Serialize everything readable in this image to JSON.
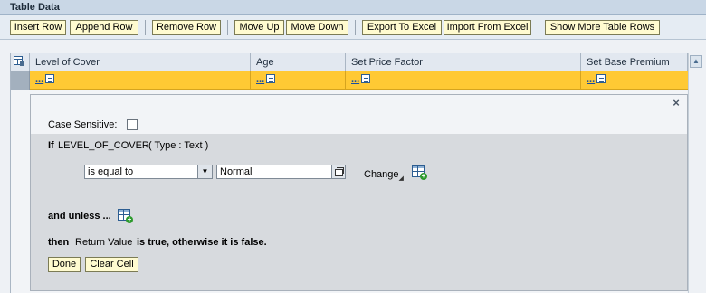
{
  "panel": {
    "title": "Table Data"
  },
  "toolbar": {
    "insert_row": "Insert Row",
    "append_row": "Append Row",
    "remove_row": "Remove Row",
    "move_up": "Move Up",
    "move_down": "Move Down",
    "export_excel": "Export To Excel",
    "import_excel": "Import From Excel",
    "show_more_rows": "Show More Table Rows"
  },
  "table": {
    "columns": [
      "Level of Cover",
      "Age",
      "Set Price Factor",
      "Set Base Premium"
    ],
    "row": {
      "cell_text": "..."
    }
  },
  "editor": {
    "close": "×",
    "case_sensitive_label": "Case Sensitive:",
    "case_sensitive_checked": false,
    "if_keyword": "If",
    "if_field": "LEVEL_OF_COVER",
    "if_type": "( Type : Text )",
    "operator": "is equal to",
    "value": "Normal",
    "change_label": "Change",
    "and_unless": "and unless ...",
    "then_keyword": "then",
    "return_value": "Return Value",
    "then_rest": "is true, otherwise it is false.",
    "done": "Done",
    "clear_cell": "Clear Cell"
  },
  "colors": {
    "selected_row": "#ffc934",
    "button_bg": "#fffbd0",
    "header_bg": "#c9d7e6"
  },
  "icons": [
    "table-settings-icon",
    "edit-cell-icon",
    "dropdown-arrow-icon",
    "value-help-icon",
    "add-table-icon",
    "close-icon",
    "scroll-up-icon"
  ]
}
